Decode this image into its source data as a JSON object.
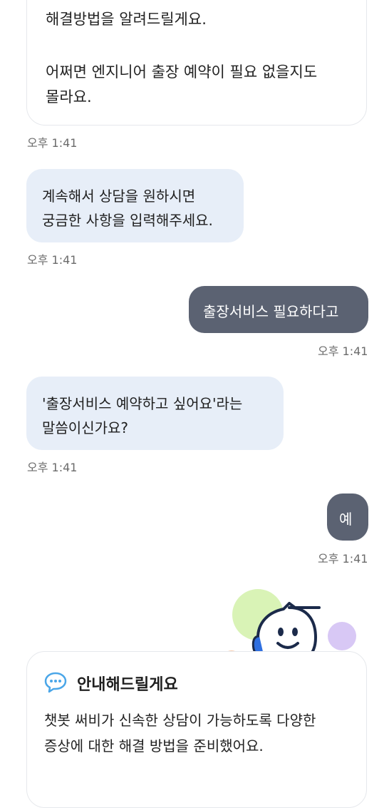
{
  "top_card": {
    "line1": "해결방법을 알려드릴게요.",
    "line2": "어쩌면 엔지니어 출장 예약이 필요 없을지도",
    "line3": "몰라요."
  },
  "messages": [
    {
      "from": "bot",
      "lines": [
        "계속해서 상담을 원하시면",
        "궁금한 사항을 입력해주세요."
      ],
      "time": "오후 1:41"
    },
    {
      "from": "user",
      "lines": [
        "출장서비스 필요하다고"
      ],
      "time": "오후 1:41"
    },
    {
      "from": "bot",
      "lines": [
        "'출장서비스 예약하고 싶어요'라는",
        "말씀이신가요?"
      ],
      "time": "오후 1:41"
    },
    {
      "from": "user",
      "lines": [
        "예"
      ],
      "time": "오후 1:41"
    }
  ],
  "top_card_time": "오후 1:41",
  "info_card": {
    "title": "안내해드릴게요",
    "line1": "챗봇 써비가 신속한 상담이 가능하도록 다양한",
    "line2": "증상에 대한 해결 방법을 준비했어요.",
    "icon": "chat-bubble-icon"
  },
  "mascot": {
    "icon": "chatbot-mascot-icon",
    "colors": {
      "green": "#d9f3b6",
      "purple": "#d8c8f5",
      "orange": "#f8ccae",
      "outline": "#1b2a4a",
      "headset": "#2f6fe0"
    }
  },
  "colors": {
    "bot_bubble": "#e7eef8",
    "user_bubble": "#5b6272",
    "info_icon": "#4aa6e8"
  }
}
